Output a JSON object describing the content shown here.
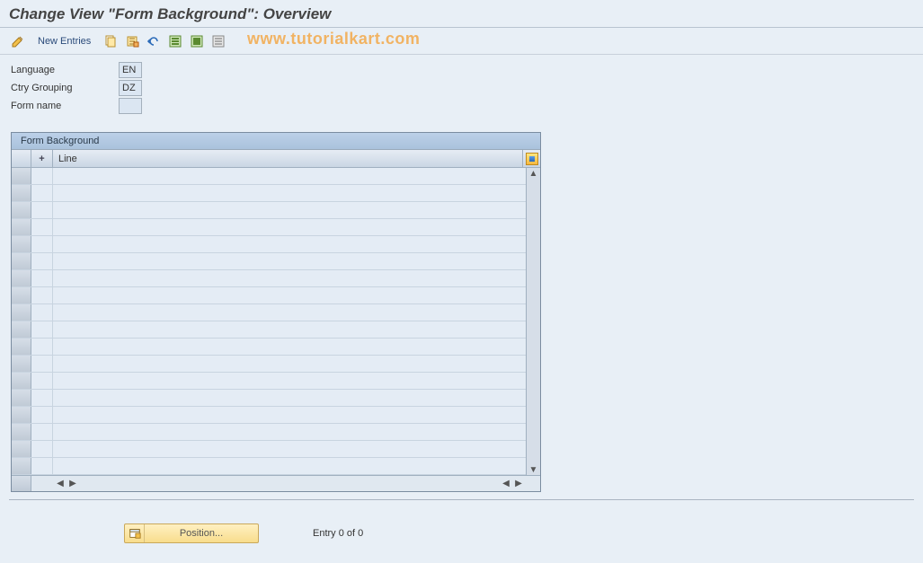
{
  "title": "Change View \"Form Background\": Overview",
  "watermark": "www.tutorialkart.com",
  "toolbar": {
    "new_entries": "New Entries",
    "icons": {
      "edit": "edit-icon",
      "copy": "copy-icon",
      "delete": "delete-icon",
      "undo": "undo-icon",
      "select_all": "select-all-icon",
      "deselect_all": "deselect-all-icon",
      "config": "config-icon"
    }
  },
  "fields": {
    "language": {
      "label": "Language",
      "value": "EN"
    },
    "ctry_grouping": {
      "label": "Ctry Grouping",
      "value": "DZ"
    },
    "form_name": {
      "label": "Form name",
      "value": ""
    }
  },
  "grid": {
    "title": "Form Background",
    "columns": {
      "plus": "+",
      "line": "Line"
    },
    "row_count": 18
  },
  "footer": {
    "position_label": "Position...",
    "entry_status": "Entry 0 of 0"
  }
}
